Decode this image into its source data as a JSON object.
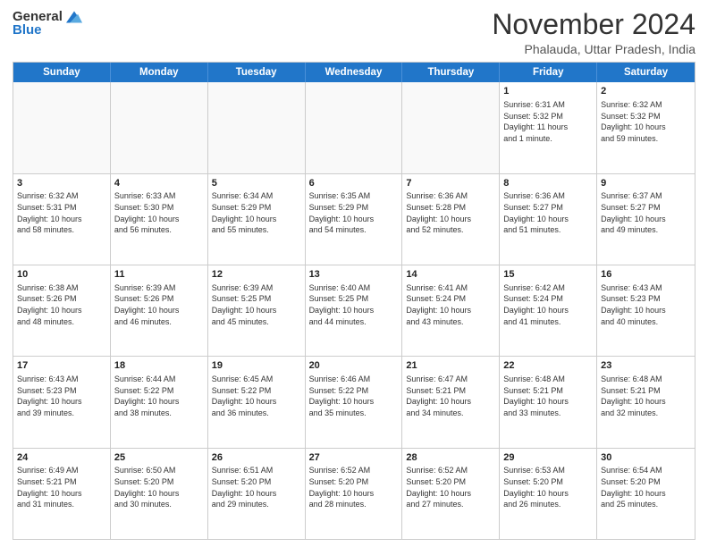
{
  "logo": {
    "general": "General",
    "blue": "Blue"
  },
  "title": "November 2024",
  "location": "Phalauda, Uttar Pradesh, India",
  "header": {
    "days": [
      "Sunday",
      "Monday",
      "Tuesday",
      "Wednesday",
      "Thursday",
      "Friday",
      "Saturday"
    ]
  },
  "weeks": [
    {
      "cells": [
        {
          "empty": true
        },
        {
          "empty": true
        },
        {
          "empty": true
        },
        {
          "empty": true
        },
        {
          "empty": true
        },
        {
          "day": "1",
          "text": "Sunrise: 6:31 AM\nSunset: 5:32 PM\nDaylight: 11 hours\nand 1 minute."
        },
        {
          "day": "2",
          "text": "Sunrise: 6:32 AM\nSunset: 5:32 PM\nDaylight: 10 hours\nand 59 minutes."
        }
      ]
    },
    {
      "cells": [
        {
          "day": "3",
          "text": "Sunrise: 6:32 AM\nSunset: 5:31 PM\nDaylight: 10 hours\nand 58 minutes."
        },
        {
          "day": "4",
          "text": "Sunrise: 6:33 AM\nSunset: 5:30 PM\nDaylight: 10 hours\nand 56 minutes."
        },
        {
          "day": "5",
          "text": "Sunrise: 6:34 AM\nSunset: 5:29 PM\nDaylight: 10 hours\nand 55 minutes."
        },
        {
          "day": "6",
          "text": "Sunrise: 6:35 AM\nSunset: 5:29 PM\nDaylight: 10 hours\nand 54 minutes."
        },
        {
          "day": "7",
          "text": "Sunrise: 6:36 AM\nSunset: 5:28 PM\nDaylight: 10 hours\nand 52 minutes."
        },
        {
          "day": "8",
          "text": "Sunrise: 6:36 AM\nSunset: 5:27 PM\nDaylight: 10 hours\nand 51 minutes."
        },
        {
          "day": "9",
          "text": "Sunrise: 6:37 AM\nSunset: 5:27 PM\nDaylight: 10 hours\nand 49 minutes."
        }
      ]
    },
    {
      "cells": [
        {
          "day": "10",
          "text": "Sunrise: 6:38 AM\nSunset: 5:26 PM\nDaylight: 10 hours\nand 48 minutes."
        },
        {
          "day": "11",
          "text": "Sunrise: 6:39 AM\nSunset: 5:26 PM\nDaylight: 10 hours\nand 46 minutes."
        },
        {
          "day": "12",
          "text": "Sunrise: 6:39 AM\nSunset: 5:25 PM\nDaylight: 10 hours\nand 45 minutes."
        },
        {
          "day": "13",
          "text": "Sunrise: 6:40 AM\nSunset: 5:25 PM\nDaylight: 10 hours\nand 44 minutes."
        },
        {
          "day": "14",
          "text": "Sunrise: 6:41 AM\nSunset: 5:24 PM\nDaylight: 10 hours\nand 43 minutes."
        },
        {
          "day": "15",
          "text": "Sunrise: 6:42 AM\nSunset: 5:24 PM\nDaylight: 10 hours\nand 41 minutes."
        },
        {
          "day": "16",
          "text": "Sunrise: 6:43 AM\nSunset: 5:23 PM\nDaylight: 10 hours\nand 40 minutes."
        }
      ]
    },
    {
      "cells": [
        {
          "day": "17",
          "text": "Sunrise: 6:43 AM\nSunset: 5:23 PM\nDaylight: 10 hours\nand 39 minutes."
        },
        {
          "day": "18",
          "text": "Sunrise: 6:44 AM\nSunset: 5:22 PM\nDaylight: 10 hours\nand 38 minutes."
        },
        {
          "day": "19",
          "text": "Sunrise: 6:45 AM\nSunset: 5:22 PM\nDaylight: 10 hours\nand 36 minutes."
        },
        {
          "day": "20",
          "text": "Sunrise: 6:46 AM\nSunset: 5:22 PM\nDaylight: 10 hours\nand 35 minutes."
        },
        {
          "day": "21",
          "text": "Sunrise: 6:47 AM\nSunset: 5:21 PM\nDaylight: 10 hours\nand 34 minutes."
        },
        {
          "day": "22",
          "text": "Sunrise: 6:48 AM\nSunset: 5:21 PM\nDaylight: 10 hours\nand 33 minutes."
        },
        {
          "day": "23",
          "text": "Sunrise: 6:48 AM\nSunset: 5:21 PM\nDaylight: 10 hours\nand 32 minutes."
        }
      ]
    },
    {
      "cells": [
        {
          "day": "24",
          "text": "Sunrise: 6:49 AM\nSunset: 5:21 PM\nDaylight: 10 hours\nand 31 minutes."
        },
        {
          "day": "25",
          "text": "Sunrise: 6:50 AM\nSunset: 5:20 PM\nDaylight: 10 hours\nand 30 minutes."
        },
        {
          "day": "26",
          "text": "Sunrise: 6:51 AM\nSunset: 5:20 PM\nDaylight: 10 hours\nand 29 minutes."
        },
        {
          "day": "27",
          "text": "Sunrise: 6:52 AM\nSunset: 5:20 PM\nDaylight: 10 hours\nand 28 minutes."
        },
        {
          "day": "28",
          "text": "Sunrise: 6:52 AM\nSunset: 5:20 PM\nDaylight: 10 hours\nand 27 minutes."
        },
        {
          "day": "29",
          "text": "Sunrise: 6:53 AM\nSunset: 5:20 PM\nDaylight: 10 hours\nand 26 minutes."
        },
        {
          "day": "30",
          "text": "Sunrise: 6:54 AM\nSunset: 5:20 PM\nDaylight: 10 hours\nand 25 minutes."
        }
      ]
    }
  ]
}
